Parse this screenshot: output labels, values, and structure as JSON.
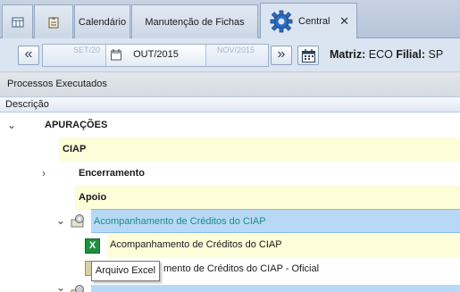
{
  "tabs": [
    {
      "label": "",
      "icon": "grid-icon"
    },
    {
      "label": "",
      "icon": "clipboard-icon"
    },
    {
      "label": "Calendário"
    },
    {
      "label": "Manutenção de Fichas"
    },
    {
      "label": "Central",
      "icon": "gear-icon",
      "active": true,
      "close": "✕"
    }
  ],
  "toolbar": {
    "prev_label": "«",
    "next_label": "»",
    "period_prev": "SET/20",
    "period_current": "OUT/2015",
    "period_next": "NOV/2015",
    "matriz_label": "Matriz:",
    "matriz_value": "ECO",
    "filial_label": "Filial:",
    "filial_value": "SP"
  },
  "section_title": "Processos Executados",
  "column_header": "Descrição",
  "tree": [
    {
      "label": "APURAÇÕES",
      "level": 0,
      "expanded": true,
      "bold": true
    },
    {
      "label": "CIAP",
      "level": 1,
      "bold": true
    },
    {
      "label": "Encerramento",
      "level": 2,
      "expanded": false,
      "bold": true
    },
    {
      "label": "Apoio",
      "level": 2,
      "bold": true
    },
    {
      "label": "Acompanhamento de Créditos do CIAP",
      "level": 3,
      "expanded": true,
      "selected": true
    },
    {
      "label": "Acompanhamento de Créditos do CIAP",
      "level": 4,
      "icon": "excel-icon"
    },
    {
      "label": "mento de Créditos do CIAP - Oficial",
      "level": 4
    }
  ],
  "tooltip": "Arquivo Excel",
  "colors": {
    "accent_blue": "#b8d9f6",
    "row_yellow": "#fdfdd9",
    "link_teal": "#1b8a8a",
    "excel_green": "#1f8f3e"
  }
}
